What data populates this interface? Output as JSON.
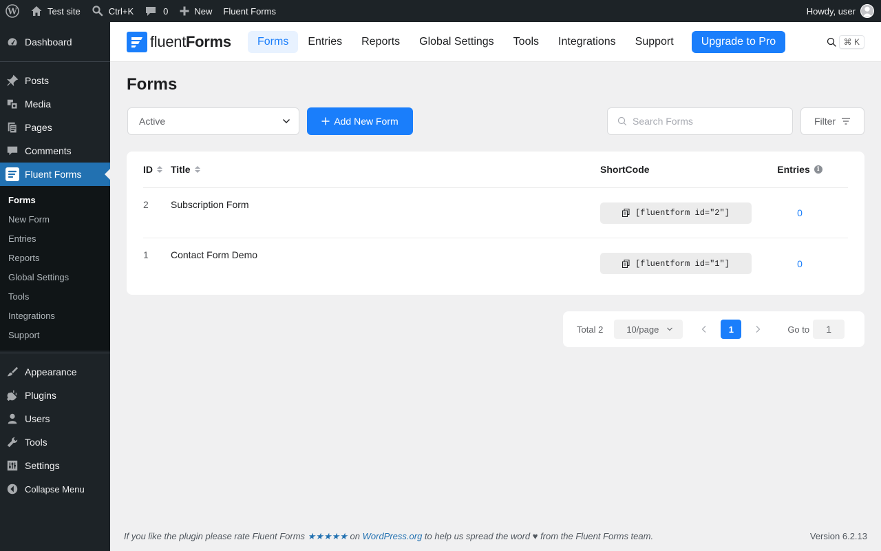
{
  "admin_bar": {
    "site_name": "Test site",
    "search_shortcut": "Ctrl+K",
    "comments_count": "0",
    "new_label": "New",
    "plugin_label": "Fluent Forms",
    "greeting": "Howdy, user"
  },
  "sidebar": {
    "items_top": [
      {
        "label": "Dashboard",
        "icon": "dashboard-icon"
      },
      {
        "label": "Posts",
        "icon": "pin-icon"
      },
      {
        "label": "Media",
        "icon": "media-icon"
      },
      {
        "label": "Pages",
        "icon": "pages-icon"
      },
      {
        "label": "Comments",
        "icon": "comment-icon"
      },
      {
        "label": "Fluent Forms",
        "icon": "fluent-forms-icon"
      }
    ],
    "submenu": [
      "Forms",
      "New Form",
      "Entries",
      "Reports",
      "Global Settings",
      "Tools",
      "Integrations",
      "Support"
    ],
    "items_bottom": [
      {
        "label": "Appearance",
        "icon": "brush-icon"
      },
      {
        "label": "Plugins",
        "icon": "plug-icon"
      },
      {
        "label": "Users",
        "icon": "user-icon"
      },
      {
        "label": "Tools",
        "icon": "wrench-icon"
      },
      {
        "label": "Settings",
        "icon": "settings-icon"
      },
      {
        "label": "Collapse Menu",
        "icon": "collapse-icon"
      }
    ]
  },
  "header": {
    "brand_light": "fluent",
    "brand_bold": "Forms",
    "nav": [
      "Forms",
      "Entries",
      "Reports",
      "Global Settings",
      "Tools",
      "Integrations",
      "Support"
    ],
    "upgrade": "Upgrade to Pro",
    "shortcut": "⌘ K"
  },
  "page": {
    "title": "Forms",
    "status_selected": "Active",
    "add_button": "Add New Form",
    "search_placeholder": "Search Forms",
    "filter_label": "Filter"
  },
  "table": {
    "columns": {
      "id": "ID",
      "title": "Title",
      "shortcode": "ShortCode",
      "entries": "Entries"
    },
    "rows": [
      {
        "id": "2",
        "title": "Subscription Form",
        "shortcode": "[fluentform id=\"2\"]",
        "entries": "0"
      },
      {
        "id": "1",
        "title": "Contact Form Demo",
        "shortcode": "[fluentform id=\"1\"]",
        "entries": "0"
      }
    ]
  },
  "pagination": {
    "total": "Total 2",
    "per_page": "10/page",
    "current_page": "1",
    "goto_label": "Go to",
    "goto_value": "1"
  },
  "footer": {
    "text_before": "If you like the plugin please rate Fluent Forms ",
    "stars": "★★★★★",
    "text_on": " on ",
    "link": "WordPress.org",
    "text_after": " to help us spread the word ♥ from the Fluent Forms team.",
    "version": "Version 6.2.13"
  },
  "colors": {
    "accent": "#1a7efb",
    "wp_dark": "#1d2327",
    "wp_current": "#2271b1"
  }
}
